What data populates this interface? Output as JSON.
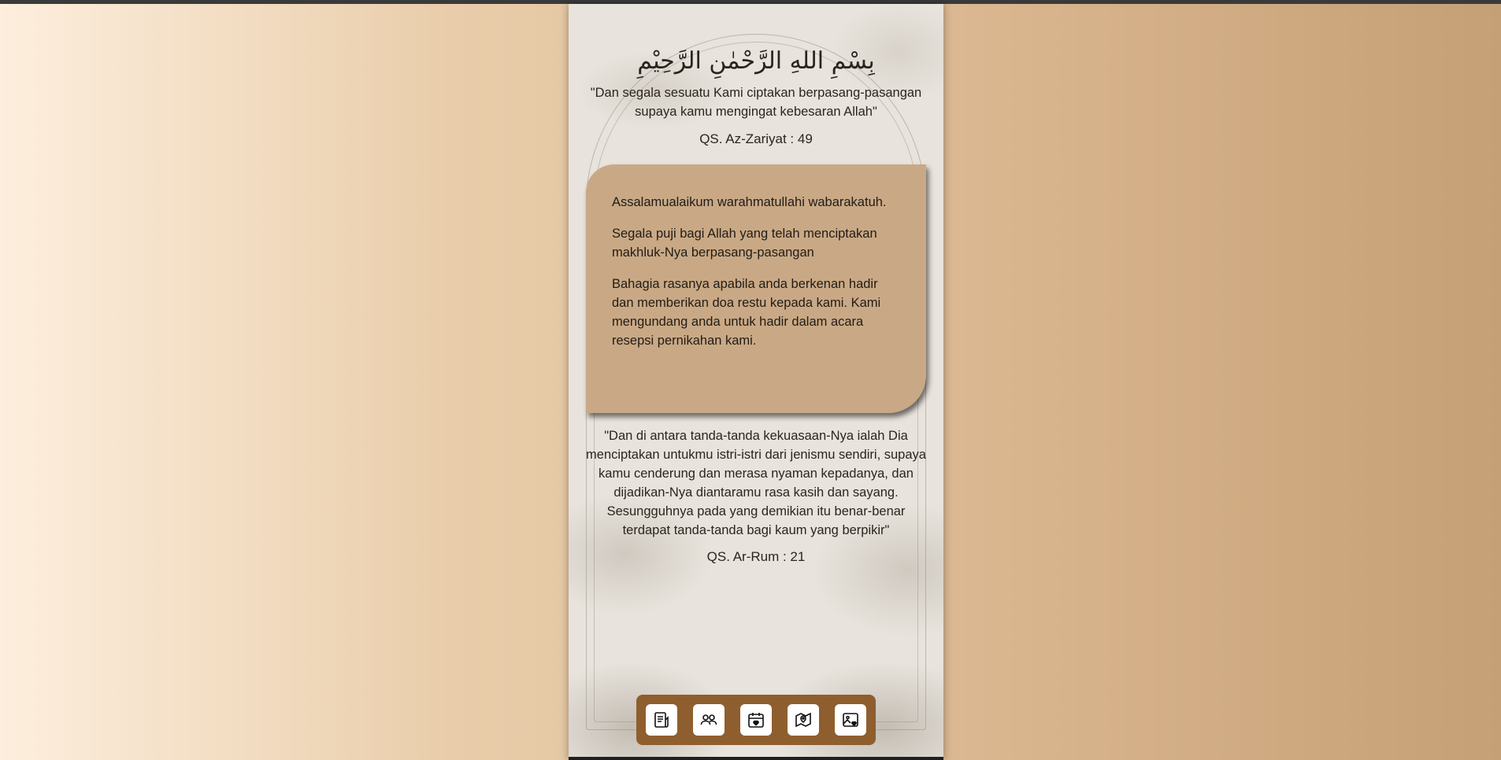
{
  "header": {
    "bismillah": "بِسْمِ اللهِ الرَّحْمٰنِ الرَّحِيْمِ",
    "quote": "\"Dan segala sesuatu Kami ciptakan berpasang-pasangan supaya kamu mengingat kebesaran Allah\"",
    "reference": "QS. Az-Zariyat : 49"
  },
  "greeting_card": {
    "paragraphs": [
      "Assalamualaikum warahmatullahi wabarakatuh.",
      "Segala puji bagi Allah yang telah menciptakan makhluk-Nya berpasang-pasangan",
      "Bahagia rasanya apabila anda berkenan hadir dan memberikan doa restu kepada kami. Kami mengundang anda untuk hadir dalam acara resepsi pernikahan kami."
    ],
    "background_color": "#c9a985"
  },
  "second_verse": {
    "quote": "\"Dan di antara tanda-tanda kekuasaan-Nya ialah Dia menciptakan untukmu istri-istri dari jenismu sendiri, supaya kamu cenderung dan merasa nyaman kepadanya, dan dijadikan-Nya diantaramu rasa kasih dan sayang. Sesungguhnya pada yang demikian itu benar-benar terdapat tanda-tanda bagi kaum yang berpikir\"",
    "reference": "QS. Ar-Rum : 21"
  },
  "bottom_nav": {
    "background_color": "#8e5e2e",
    "items": [
      {
        "icon": "document-icon"
      },
      {
        "icon": "people-icon"
      },
      {
        "icon": "calendar-heart-icon"
      },
      {
        "icon": "map-pin-icon"
      },
      {
        "icon": "gallery-heart-icon"
      }
    ]
  }
}
